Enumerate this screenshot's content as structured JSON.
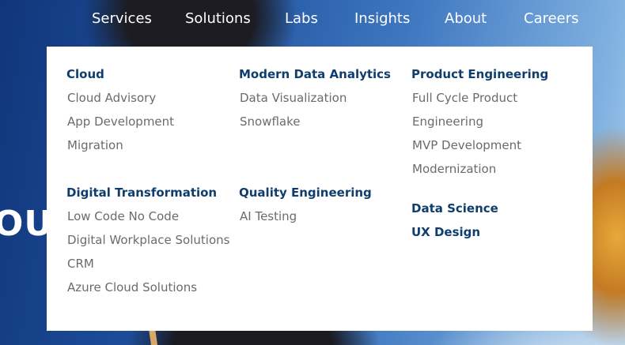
{
  "nav": {
    "items": [
      "Services",
      "Solutions",
      "Labs",
      "Insights",
      "About",
      "Careers"
    ]
  },
  "hero": {
    "visible_text": "OU"
  },
  "menu": {
    "col1": {
      "group1": {
        "heading": "Cloud",
        "links": [
          "Cloud Advisory",
          "App Development",
          "Migration"
        ]
      },
      "group2": {
        "heading": "Digital Transformation",
        "links": [
          "Low Code No Code",
          "Digital Workplace Solutions",
          "CRM",
          "Azure Cloud Solutions"
        ]
      }
    },
    "col2": {
      "group1": {
        "heading": "Modern Data Analytics",
        "links": [
          "Data Visualization",
          "Snowflake"
        ]
      },
      "group2": {
        "heading": "Quality Engineering",
        "links": [
          "AI Testing"
        ]
      }
    },
    "col3": {
      "group1": {
        "heading": "Product Engineering",
        "links": [
          "Full Cycle Product",
          "Engineering",
          "MVP Development",
          "Modernization"
        ]
      },
      "group2": {
        "heading": "Data Science"
      },
      "group3": {
        "heading": "UX Design"
      }
    }
  },
  "colors": {
    "heading": "#0f3d6e",
    "link": "#6b6b6b",
    "panel_bg": "#ffffff",
    "nav_text": "#ffffff"
  }
}
